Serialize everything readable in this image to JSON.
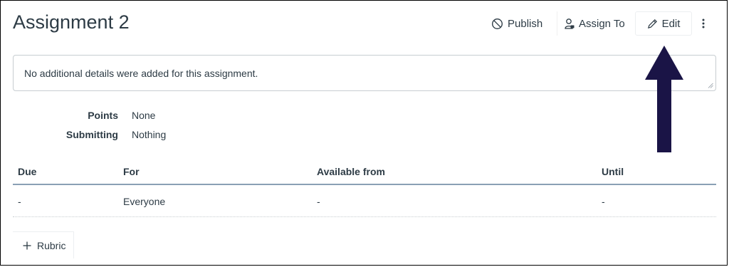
{
  "page": {
    "title": "Assignment 2"
  },
  "toolbar": {
    "publish_label": "Publish",
    "assign_label": "Assign To",
    "edit_label": "Edit",
    "more_icon": "more-vertical-icon"
  },
  "details": {
    "text": "No additional details were added for this assignment."
  },
  "meta": [
    {
      "label": "Points",
      "value": "None"
    },
    {
      "label": "Submitting",
      "value": "Nothing"
    }
  ],
  "dates_table": {
    "headers": [
      "Due",
      "For",
      "Available from",
      "Until"
    ],
    "rows": [
      [
        "-",
        "Everyone",
        "-",
        "-"
      ]
    ]
  },
  "rubric": {
    "label": "Rubric"
  },
  "annotation": {
    "color": "#1a1446"
  },
  "colors": {
    "text": "#2d3b45",
    "table_divider": "#8aa0b4"
  }
}
